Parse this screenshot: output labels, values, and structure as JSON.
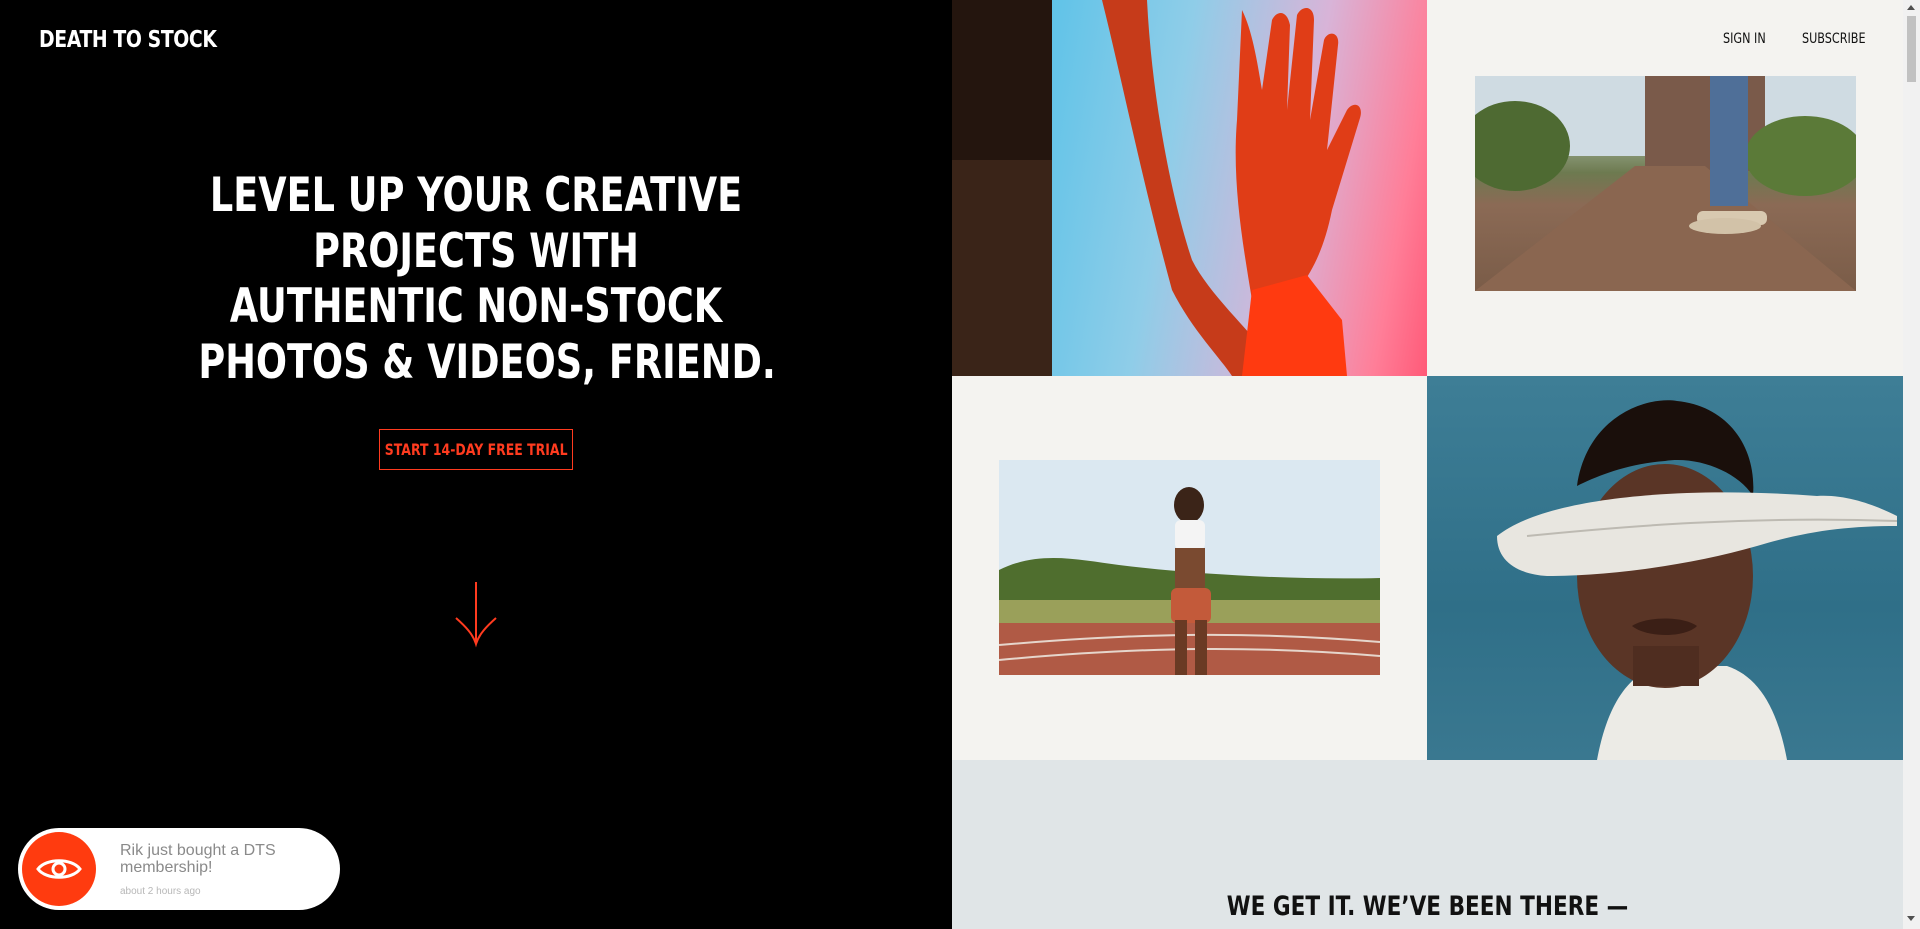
{
  "header": {
    "logo": "DEATH TO STOCK",
    "nav": {
      "sign_in": "SIGN IN",
      "subscribe": "SUBSCRIBE"
    }
  },
  "hero": {
    "title_lines": [
      "LEVEL UP YOUR CREATIVE",
      "PROJECTS WITH",
      "AUTHENTIC NON-STOCK",
      "PHOTOS & VIDEOS, FRIEND."
    ],
    "cta_label": "START 14-DAY FREE TRIAL",
    "scroll_icon": "arrow-down-icon"
  },
  "gallery": {
    "tiles": [
      "hand-on-wet-glass-photo",
      "skateboard-video",
      "runner-track-video",
      "feather-over-eyes-photo"
    ]
  },
  "section": {
    "title": "WE GET IT. WE’VE BEEN THERE —"
  },
  "notification": {
    "icon": "eye-icon",
    "message": "Rik just bought a DTS membership!",
    "time": "about 2 hours ago"
  },
  "colors": {
    "accent": "#ff3b1f",
    "background_dark": "#000000",
    "panel_light": "#f4f3f0",
    "section_bg": "#e0e5e7"
  }
}
